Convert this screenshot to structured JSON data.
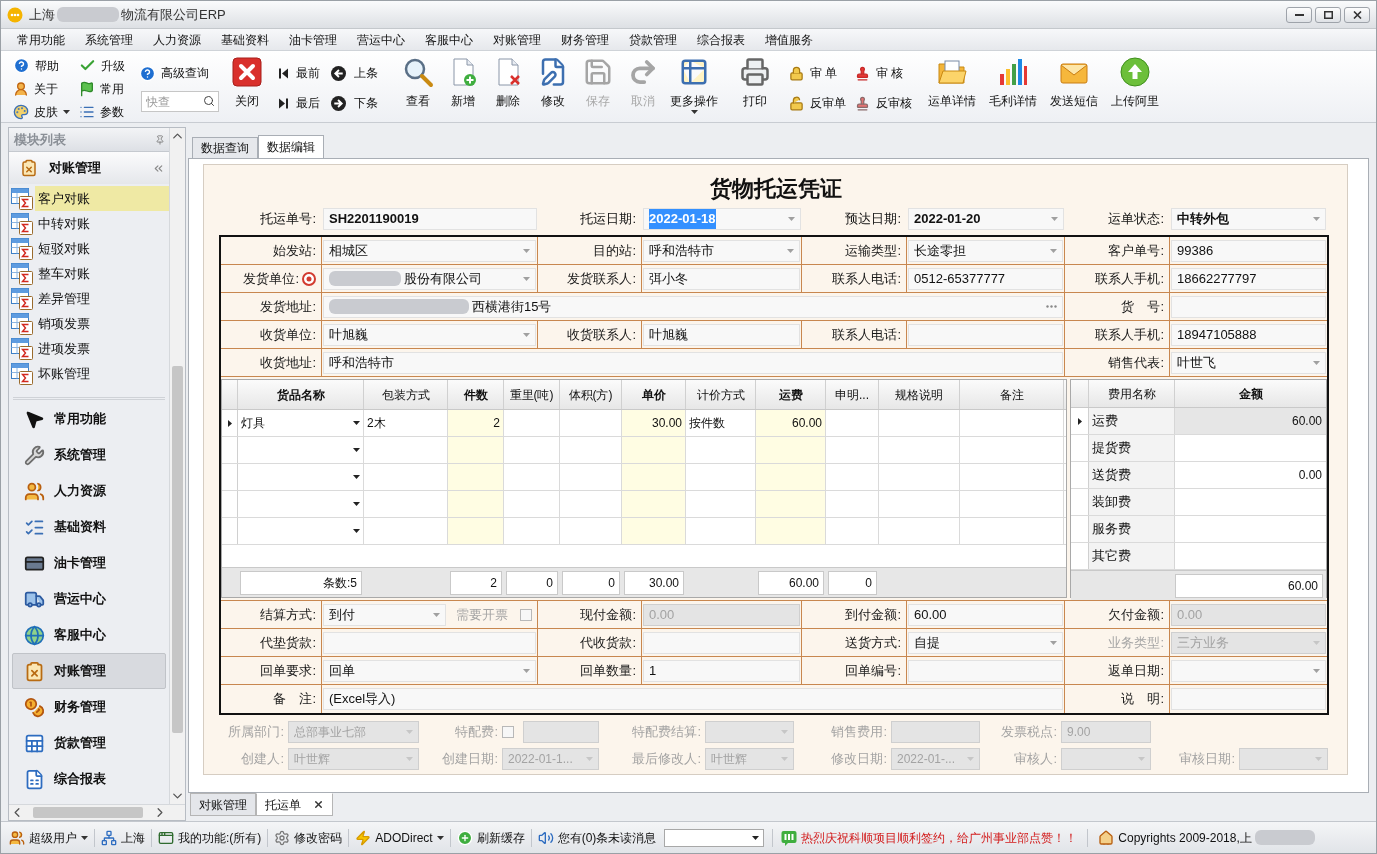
{
  "window": {
    "title": [
      {
        "kind": "text",
        "text": "上海"
      },
      {
        "kind": "blur"
      },
      {
        "kind": "text",
        "text": "物流有限公司ERP"
      }
    ]
  },
  "menu": [
    "常用功能",
    "系统管理",
    "人力资源",
    "基础资料",
    "油卡管理",
    "营运中心",
    "客服中心",
    "对账管理",
    "财务管理",
    "贷款管理",
    "综合报表",
    "增值服务"
  ],
  "toolbar": {
    "small": [
      {
        "label": "帮助",
        "dropdown": false
      },
      {
        "label": "关于",
        "dropdown": false
      },
      {
        "label": "皮肤",
        "dropdown": true
      },
      {
        "label": "升级",
        "dropdown": false
      },
      {
        "label": "常用",
        "dropdown": false
      },
      {
        "label": "参数",
        "dropdown": false
      }
    ],
    "advanced_query": "高级查询",
    "quick_search": {
      "placeholder": "快查"
    },
    "close": "关闭",
    "nav": [
      "最前",
      "最后",
      "上条",
      "下条"
    ],
    "actions": [
      {
        "label": "查看",
        "disabled": false,
        "dropdown": false
      },
      {
        "label": "新增",
        "disabled": false,
        "dropdown": false
      },
      {
        "label": "删除",
        "disabled": false,
        "dropdown": false
      },
      {
        "label": "修改",
        "disabled": false,
        "dropdown": false
      },
      {
        "label": "保存",
        "disabled": true,
        "dropdown": false
      },
      {
        "label": "取消",
        "disabled": true,
        "dropdown": false
      },
      {
        "label": "更多操作",
        "disabled": false,
        "dropdown": true
      },
      {
        "label": "打印",
        "disabled": false,
        "dropdown": false
      }
    ],
    "audit": [
      "审 单",
      "反审单",
      "审 核",
      "反审核"
    ],
    "reports": [
      "运单详情",
      "毛利详情",
      "发送短信",
      "上传阿里"
    ]
  },
  "sidebar": {
    "title": "模块列表",
    "group": {
      "title": "对账管理",
      "items": [
        {
          "label": "客户对账",
          "selected": true
        },
        {
          "label": "中转对账",
          "selected": false
        },
        {
          "label": "短驳对账",
          "selected": false
        },
        {
          "label": "整车对账",
          "selected": false
        },
        {
          "label": "差异管理",
          "selected": false
        },
        {
          "label": "销项发票",
          "selected": false
        },
        {
          "label": "进项发票",
          "selected": false
        },
        {
          "label": "坏账管理",
          "selected": false
        }
      ]
    },
    "modules": [
      {
        "label": "常用功能",
        "selected": false
      },
      {
        "label": "系统管理",
        "selected": false
      },
      {
        "label": "人力资源",
        "selected": false
      },
      {
        "label": "基础资料",
        "selected": false
      },
      {
        "label": "油卡管理",
        "selected": false
      },
      {
        "label": "营运中心",
        "selected": false
      },
      {
        "label": "客服中心",
        "selected": false
      },
      {
        "label": "对账管理",
        "selected": true
      },
      {
        "label": "财务管理",
        "selected": false
      },
      {
        "label": "货款管理",
        "selected": false
      },
      {
        "label": "综合报表",
        "selected": false
      }
    ]
  },
  "tabs": [
    {
      "label": "数据查询",
      "selected": false
    },
    {
      "label": "数据编辑",
      "selected": true
    }
  ],
  "form": {
    "title": "货物托运凭证",
    "header": [
      {
        "label": "托运单号:",
        "value": "SH2201190019",
        "kind": "text",
        "focused": false
      },
      {
        "label": "托运日期:",
        "value": "2022-01-18",
        "kind": "combo",
        "focused": true
      },
      {
        "label": "预达日期:",
        "value": "2022-01-20",
        "kind": "combo",
        "focused": false
      },
      {
        "label": "运单状态:",
        "value": "中转外包",
        "kind": "combo",
        "focused": false
      }
    ],
    "rows": [
      [
        {
          "label": "始发站:",
          "value": "相城区",
          "kind": "combo"
        },
        {
          "label": "目的站:",
          "value": "呼和浩特市",
          "kind": "combo"
        },
        {
          "label": "运输类型:",
          "value": "长途零担",
          "kind": "combo"
        },
        {
          "label": "客户单号:",
          "value": "99386",
          "kind": "text"
        }
      ],
      [
        {
          "label": "发货单位:",
          "value_parts": [
            {
              "kind": "blur"
            },
            {
              "kind": "text",
              "text": "股份有限公司"
            }
          ],
          "kind": "lookup"
        },
        {
          "label": "发货联系人:",
          "value": "弭小冬",
          "kind": "text"
        },
        {
          "label": "联系人电话:",
          "value": "0512-65377777",
          "kind": "text"
        },
        {
          "label": "联系人手机:",
          "value": "18662277797",
          "kind": "text"
        }
      ],
      [
        {
          "label": "发货地址:",
          "value_parts": [
            {
              "kind": "blur"
            },
            {
              "kind": "text",
              "text": "西横港街15号"
            }
          ],
          "kind": "address"
        },
        {
          "label": "货　号:",
          "kind": "text"
        }
      ],
      [
        {
          "label": "收货单位:",
          "value": "叶旭巍",
          "kind": "combo"
        },
        {
          "label": "收货联系人:",
          "value": "叶旭巍",
          "kind": "text"
        },
        {
          "label": "联系人电话:",
          "kind": "text"
        },
        {
          "label": "联系人手机:",
          "value": "18947105888",
          "kind": "text"
        }
      ],
      [
        {
          "label": "收货地址:",
          "value": "呼和浩特市",
          "kind": "wide"
        },
        {
          "label": "销售代表:",
          "value": "叶世飞",
          "kind": "combo"
        }
      ]
    ],
    "goods": {
      "columns": [
        {
          "label": "货品名称",
          "bold": true,
          "highlighted": false
        },
        {
          "label": "包装方式",
          "bold": false,
          "highlighted": false
        },
        {
          "label": "件数",
          "bold": true,
          "highlighted": true
        },
        {
          "label": "重里(吨)",
          "bold": false,
          "highlighted": false
        },
        {
          "label": "体积(方)",
          "bold": false,
          "highlighted": false
        },
        {
          "label": "单价",
          "bold": true,
          "highlighted": true
        },
        {
          "label": "计价方式",
          "bold": false,
          "highlighted": false
        },
        {
          "label": "运费",
          "bold": true,
          "highlighted": true
        },
        {
          "label": "申明...",
          "bold": false,
          "highlighted": false
        },
        {
          "label": "规格说明",
          "bold": false,
          "highlighted": false
        },
        {
          "label": "备注",
          "bold": false,
          "highlighted": false
        }
      ],
      "rows": [
        {
          "current": true,
          "name": "灯具",
          "packing": "2木",
          "pieces": "2",
          "unit_price": "30.00",
          "pricing": "按件数",
          "freight": "60.00"
        },
        {
          "current": false
        },
        {
          "current": false
        },
        {
          "current": false
        },
        {
          "current": false
        }
      ],
      "totals": {
        "count": "条数:5",
        "pieces": "2",
        "weight": "0",
        "volume": "0",
        "unit_price": "30.00",
        "freight": "60.00",
        "declared": "0"
      }
    },
    "fees": {
      "columns": [
        {
          "label": "费用名称",
          "bold": false
        },
        {
          "label": "金额",
          "bold": true
        }
      ],
      "rows": [
        {
          "name": "运费",
          "amount": "60.00",
          "current": true
        },
        {
          "name": "提货费",
          "current": false
        },
        {
          "name": "送货费",
          "amount": "0.00",
          "current": false
        },
        {
          "name": "装卸费",
          "current": false
        },
        {
          "name": "服务费",
          "current": false
        },
        {
          "name": "其它费",
          "current": false
        }
      ],
      "total": "60.00"
    },
    "settlement": [
      [
        {
          "label": "结算方式:",
          "value": "到付",
          "kind": "combo_check",
          "disabled": false,
          "label_disabled": false,
          "check": {
            "label": "需要开票",
            "checked": false,
            "disabled": true
          }
        },
        {
          "label": "现付金额:",
          "value": "0.00",
          "kind": "text",
          "disabled": true,
          "label_disabled": false
        },
        {
          "label": "到付金额:",
          "value": "60.00",
          "kind": "text",
          "disabled": false,
          "label_disabled": false
        },
        {
          "label": "欠付金额:",
          "value": "0.00",
          "kind": "text",
          "disabled": true,
          "label_disabled": false
        }
      ],
      [
        {
          "label": "代垫货款:",
          "kind": "text",
          "disabled": false,
          "label_disabled": false
        },
        {
          "label": "代收货款:",
          "kind": "text",
          "disabled": false,
          "label_disabled": false
        },
        {
          "label": "送货方式:",
          "value": "自提",
          "kind": "combo",
          "disabled": false,
          "label_disabled": false
        },
        {
          "label": "业务类型:",
          "value": "三方业务",
          "kind": "combo",
          "disabled": true,
          "label_disabled": true
        }
      ],
      [
        {
          "label": "回单要求:",
          "value": "回单",
          "kind": "combo",
          "disabled": false,
          "label_disabled": false
        },
        {
          "label": "回单数量:",
          "value": "1",
          "kind": "text",
          "disabled": false,
          "label_disabled": false
        },
        {
          "label": "回单编号:",
          "kind": "text",
          "disabled": false,
          "label_disabled": false
        },
        {
          "label": "返单日期:",
          "kind": "combo",
          "disabled": false,
          "label_disabled": false
        }
      ],
      [
        {
          "label": "备　注:",
          "value": "(Excel导入)",
          "kind": "wide",
          "disabled": false,
          "label_disabled": false
        },
        {
          "label": "说　明:",
          "kind": "text",
          "disabled": false,
          "label_disabled": false
        }
      ]
    ],
    "meta": {
      "disabled": true,
      "rows": [
        [
          {
            "label": "所属部门:",
            "value": "总部事业七部",
            "kind": "combo"
          },
          {
            "label": "特配费:",
            "kind": "check_text",
            "checked": false
          },
          {
            "label": "特配费结算:",
            "kind": "combo"
          },
          {
            "label": "销售费用:",
            "kind": "text"
          },
          {
            "label": "发票税点:",
            "value": "9.00",
            "kind": "text"
          }
        ],
        [
          {
            "label": "创建人:",
            "value": "叶世辉",
            "kind": "combo"
          },
          {
            "label": "创建日期:",
            "value": "2022-01-1...",
            "kind": "combo"
          },
          {
            "label": "最后修改人:",
            "value": "叶世辉",
            "kind": "combo"
          },
          {
            "label": "修改日期:",
            "value": "2022-01-...",
            "kind": "combo"
          },
          {
            "label": "审核人:",
            "kind": "combo"
          },
          {
            "label": "审核日期:",
            "kind": "combo"
          }
        ]
      ]
    }
  },
  "bottom_tabs": [
    {
      "label": "对账管理",
      "selected": false,
      "closable": false
    },
    {
      "label": "托运单",
      "selected": true,
      "closable": true
    }
  ],
  "status_bar": {
    "items": [
      {
        "label": "超级用户",
        "dropdown": true
      },
      {
        "label": "上海",
        "dropdown": false
      },
      {
        "label": "我的功能:(所有)",
        "dropdown": false
      },
      {
        "label": "修改密码",
        "dropdown": false
      },
      {
        "label": "ADODirect",
        "dropdown": true
      },
      {
        "label": "刷新缓存",
        "dropdown": false
      },
      {
        "label": "您有(0)条未读消息",
        "dropdown": false
      }
    ],
    "notice": "热烈庆祝科顺项目顺利签约，给广州事业部点赞！！",
    "copyright": [
      {
        "kind": "text",
        "text": "Copyrights 2009-2018,上"
      },
      {
        "kind": "blur"
      }
    ]
  }
}
